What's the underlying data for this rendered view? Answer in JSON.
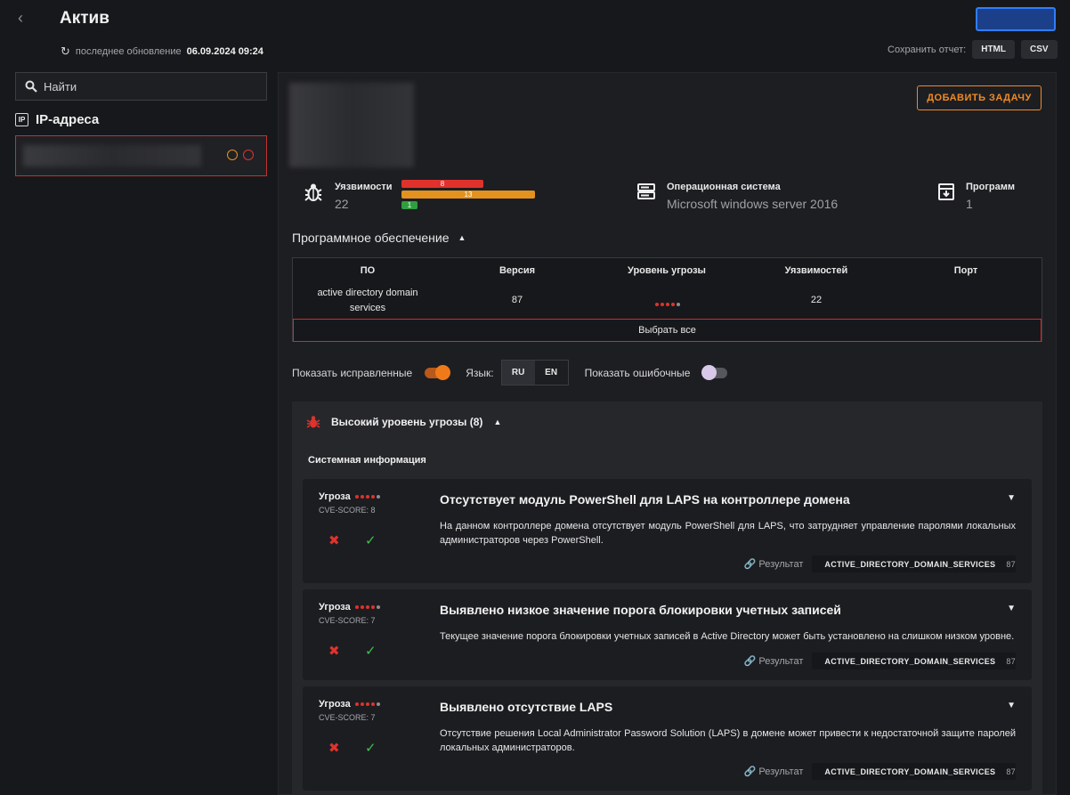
{
  "header": {
    "title": "Актив",
    "update_label": "последнее обновление",
    "update_time": "06.09.2024 09:24",
    "save_label": "Сохранить отчет:",
    "save_html": "HTML",
    "save_csv": "CSV"
  },
  "sidebar": {
    "search_placeholder": "Найти",
    "section_title": "IP-адреса",
    "section_badge": "IP"
  },
  "asset": {
    "add_task": "ДОБАВИТЬ ЗАДАЧУ",
    "stats": {
      "vuln_label": "Уязвимости",
      "vuln_value": "22",
      "bar_high": "8",
      "bar_medium": "13",
      "bar_low": "1",
      "os_label": "Операционная система",
      "os_value": "Microsoft windows server 2016",
      "prog_label": "Программ",
      "prog_value": "1"
    }
  },
  "software": {
    "title": "Программное обеспечение",
    "columns": [
      "ПО",
      "Версия",
      "Уровень угрозы",
      "Уязвимостей",
      "Порт"
    ],
    "rows": [
      {
        "name": "active directory domain services",
        "version": "87",
        "vulns": "22",
        "port": ""
      }
    ],
    "select_all": "Выбрать все"
  },
  "filters": {
    "show_fixed": "Показать исправленные",
    "lang_label": "Язык:",
    "lang_ru": "RU",
    "lang_en": "EN",
    "show_errors": "Показать ошибочные"
  },
  "threat": {
    "header": "Высокий уровень угрозы (8)",
    "subsection": "Системная информация",
    "threat_label": "Угроза",
    "result_label": "Результат",
    "cards": [
      {
        "cve": "CVE-SCORE: 8",
        "title": "Отсутствует модуль PowerShell для LAPS на контроллере домена",
        "desc": "На данном контроллере домена отсутствует модуль PowerShell для LAPS, что затрудняет управление паролями локальных администраторов через PowerShell.",
        "code": "ACTIVE_DIRECTORY_DOMAIN_SERVICES",
        "num": "87"
      },
      {
        "cve": "CVE-SCORE: 7",
        "title": "Выявлено низкое значение порога блокировки учетных записей",
        "desc": "Текущее значение порога блокировки учетных записей в Active Directory может быть установлено на слишком низком уровне.",
        "code": "ACTIVE_DIRECTORY_DOMAIN_SERVICES",
        "num": "87"
      },
      {
        "cve": "CVE-SCORE: 7",
        "title": "Выявлено отсутствие LAPS",
        "desc": "Отсутствие решения Local Administrator Password Solution (LAPS) в домене может привести к недостаточной защите паролей локальных администраторов.",
        "code": "ACTIVE_DIRECTORY_DOMAIN_SERVICES",
        "num": "87"
      }
    ]
  },
  "colors": {
    "accent": "#f08a24",
    "danger": "#e0322c",
    "medium": "#e3921f",
    "low": "#2f9e3f",
    "success": "#3fbf4f"
  }
}
